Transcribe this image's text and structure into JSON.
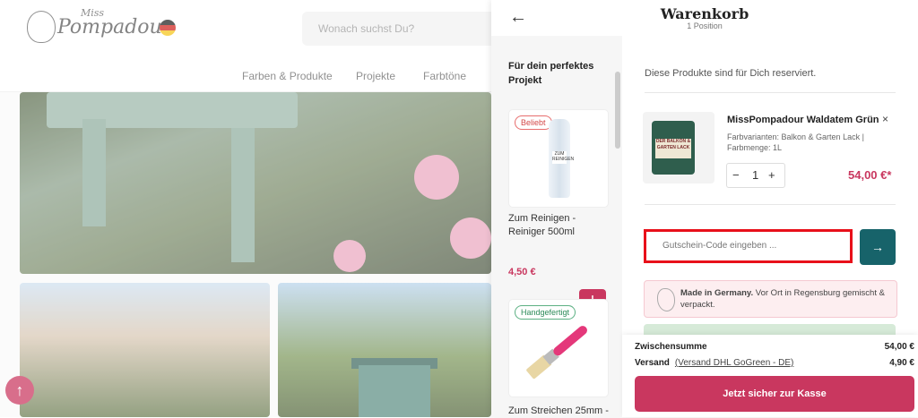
{
  "site": {
    "logo_small": "Miss",
    "logo_main": "Pompadour",
    "search_placeholder": "Wonach suchst Du?",
    "nav": [
      "Farben & Produkte",
      "Projekte",
      "Farbtöne"
    ]
  },
  "cart": {
    "title": "Warenkorb",
    "subtitle": "1 Position",
    "reserved_text": "Diese Produkte sind für Dich reserviert.",
    "recommendations": {
      "heading": "Für dein perfektes Projekt",
      "products": [
        {
          "badge": "Beliebt",
          "name": "Zum Reinigen - Reiniger 500ml",
          "price": "4,50 €",
          "bottle_label": "ZUM REINIGEN"
        },
        {
          "badge": "Handgefertigt",
          "name": "Zum Streichen 25mm -"
        }
      ],
      "add_label": "+"
    },
    "item": {
      "name": "MissPompadour Waldatem Grün",
      "variant": "Farbvarianten: Balkon & Garten Lack | Farbmenge: 1L",
      "quantity": "1",
      "minus": "−",
      "plus": "+",
      "price": "54,00 €*",
      "close": "×",
      "can_label": "DER BALKON & GARTEN LACK"
    },
    "coupon_placeholder": "Gutschein-Code eingeben ...",
    "coupon_submit": "→",
    "germany_bold": "Made in Germany.",
    "germany_rest": " Vor Ort in Regensburg gemischt & verpackt.",
    "summary": {
      "subtotal_label": "Zwischensumme",
      "subtotal_value": "54,00 €",
      "shipping_label": "Versand",
      "shipping_link": "(Versand DHL GoGreen - DE)",
      "shipping_value": "4,90 €",
      "checkout_label": "Jetzt sicher zur Kasse"
    },
    "back": "←"
  },
  "scroll_top": "↑",
  "colors": {
    "accent": "#c9375f",
    "teal": "#17636a",
    "highlight": "#e8101a"
  }
}
